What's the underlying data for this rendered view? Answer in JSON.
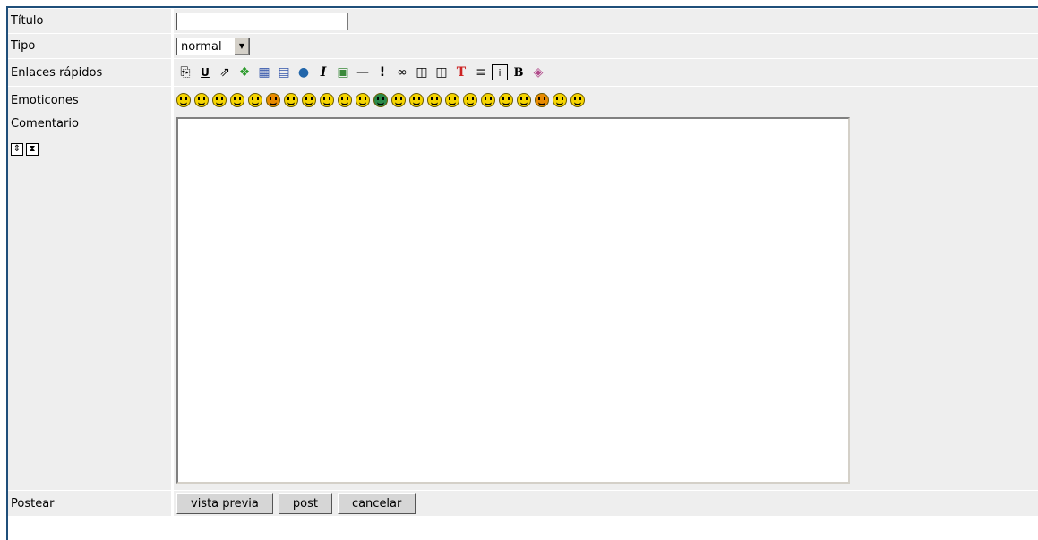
{
  "labels": {
    "titulo": "Título",
    "tipo": "Tipo",
    "enlaces": "Enlaces rápidos",
    "emoticones": "Emoticones",
    "comentario": "Comentario",
    "postear": "Postear"
  },
  "fields": {
    "titulo_value": "",
    "tipo_selected": "normal",
    "comentario_value": ""
  },
  "quick_links": [
    "copy-icon",
    "underline-icon",
    "external-link-icon",
    "paw-icon",
    "table-icon",
    "table-alt-icon",
    "globe-icon",
    "italic-icon",
    "image-icon",
    "hr-icon",
    "exclamation-icon",
    "link-icon",
    "book-icon",
    "book-alt-icon",
    "font-color-icon",
    "align-icon",
    "info-icon",
    "bold-icon",
    "box-icon"
  ],
  "emoticons_count": 24,
  "buttons": {
    "preview": "vista previa",
    "post": "post",
    "cancel": "cancelar"
  },
  "colors": {
    "border_accent": "#1f4f7a",
    "cell_bg": "#eeeeee"
  }
}
